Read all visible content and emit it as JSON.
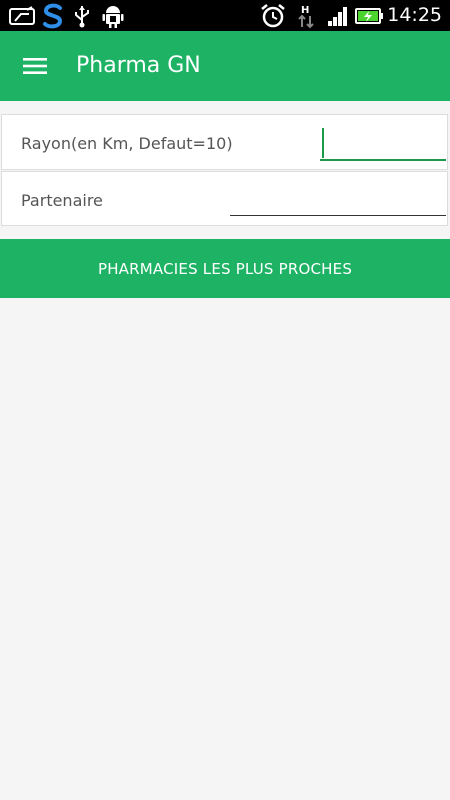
{
  "status_bar": {
    "time": "14:25",
    "icons": [
      "news-icon",
      "s-app-icon",
      "usb-icon",
      "android-debug-icon",
      "alarm-clock-icon",
      "hspa-data-icon",
      "signal-icon",
      "battery-charging-icon"
    ]
  },
  "toolbar": {
    "title": "Pharma GN",
    "menu_icon": "hamburger-menu-icon",
    "background_color": "#1db264"
  },
  "form": {
    "rayon": {
      "label": "Rayon(en Km, Defaut=10)",
      "value": ""
    },
    "partenaire": {
      "label": "Partenaire",
      "value": ""
    }
  },
  "action": {
    "label": "PHARMACIES LES PLUS PROCHES"
  },
  "colors": {
    "accent": "#1db264",
    "focus_underline": "#1a9a48",
    "background": "#f5f5f5"
  }
}
